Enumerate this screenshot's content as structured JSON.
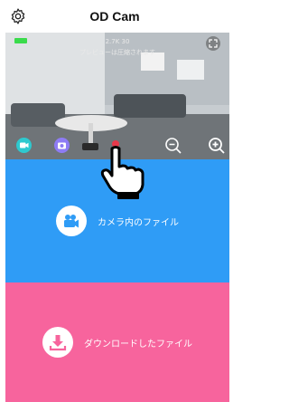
{
  "header": {
    "title": "OD Cam",
    "settings_icon": "gear-icon"
  },
  "preview": {
    "resolution": "2.7K 30",
    "notice": "プレビューは圧縮されます",
    "battery_color": "#3adb4b",
    "controls": {
      "video_mode_icon": "video-camera-icon",
      "photo_mode_icon": "camera-icon",
      "zoom_out_icon": "zoom-out-icon",
      "zoom_in_icon": "zoom-in-icon",
      "expand_icon": "fullscreen-icon"
    }
  },
  "tiles": {
    "camera_files": {
      "label": "カメラ内のファイル",
      "icon": "video-camera-icon",
      "color": "#2f9cf6"
    },
    "downloaded_files": {
      "label": "ダウンロードしたファイル",
      "icon": "download-icon",
      "color": "#f7649d"
    }
  }
}
